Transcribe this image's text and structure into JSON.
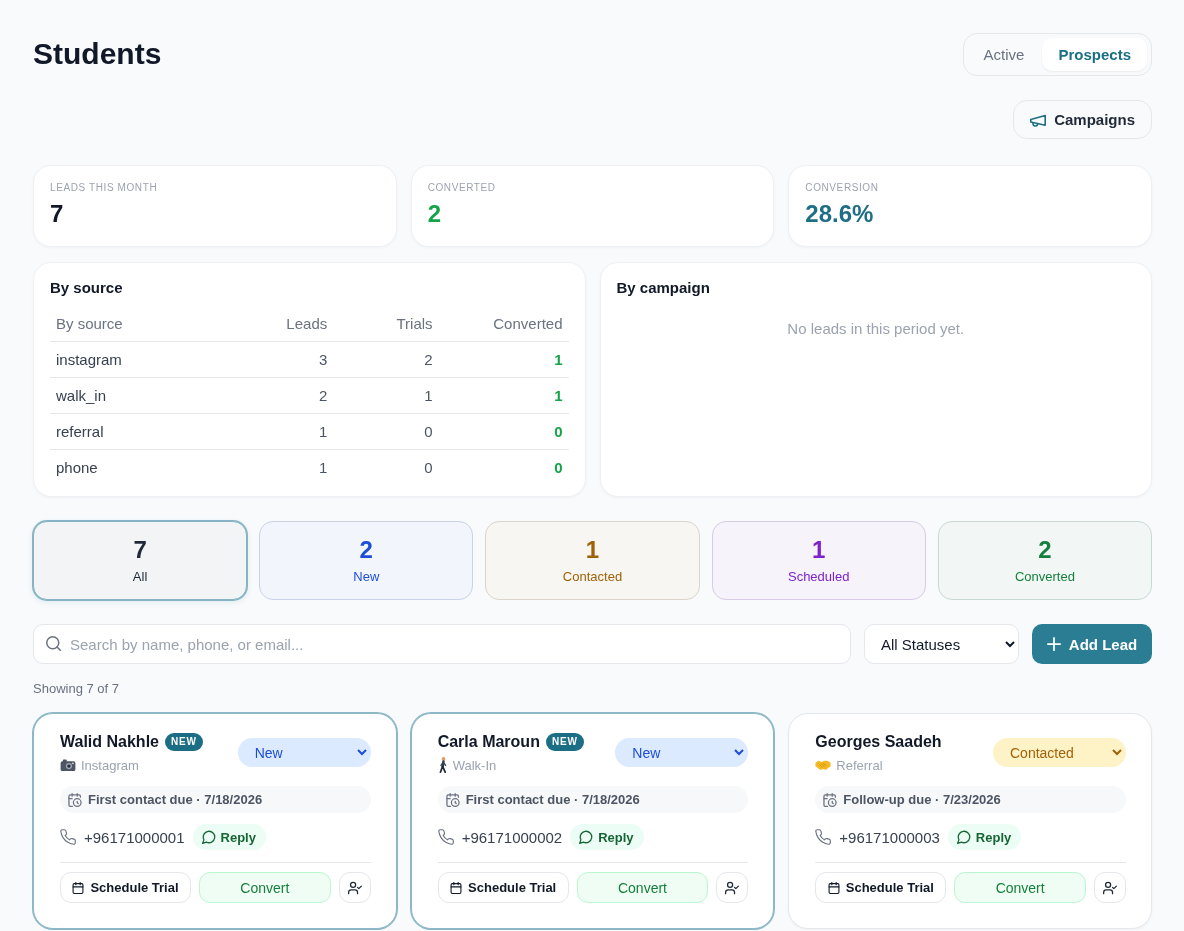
{
  "header": {
    "title": "Students",
    "view_toggle": [
      {
        "label": "Active",
        "selected": false
      },
      {
        "label": "Prospects",
        "selected": true
      }
    ],
    "campaigns_button": "Campaigns"
  },
  "stats": [
    {
      "label": "LEADS THIS MONTH",
      "value": "7",
      "color": "#111827"
    },
    {
      "label": "CONVERTED",
      "value": "2",
      "color": "#16a34a"
    },
    {
      "label": "CONVERSION",
      "value": "28.6%",
      "color": "#1e6f86"
    }
  ],
  "by_source": {
    "title": "By source",
    "columns": [
      "By source",
      "Leads",
      "Trials",
      "Converted"
    ],
    "rows": [
      {
        "cells": [
          "instagram",
          "3",
          "2",
          "1"
        ]
      },
      {
        "cells": [
          "walk_in",
          "2",
          "1",
          "1"
        ]
      },
      {
        "cells": [
          "referral",
          "1",
          "0",
          "0"
        ]
      },
      {
        "cells": [
          "phone",
          "1",
          "0",
          "0"
        ]
      }
    ]
  },
  "by_campaign": {
    "title": "By campaign",
    "empty_message": "No leads in this period yet."
  },
  "status_filters": [
    {
      "count": "7",
      "label": "All",
      "color": "#1f2937",
      "selected": true
    },
    {
      "count": "2",
      "label": "New",
      "color": "#1d4ed8",
      "selected": false
    },
    {
      "count": "1",
      "label": "Contacted",
      "color": "#a16207",
      "selected": false
    },
    {
      "count": "1",
      "label": "Scheduled",
      "color": "#7e22ce",
      "selected": false
    },
    {
      "count": "2",
      "label": "Converted",
      "color": "#15803d",
      "selected": false
    }
  ],
  "toolbar": {
    "search": {
      "placeholder": "Search by name, phone, or email..."
    },
    "status_select": {
      "value": "All Statuses"
    },
    "add_button": "Add Lead"
  },
  "result_count": "Showing 7 of 7",
  "leads": [
    {
      "name": "Walid Nakhle",
      "badge": "NEW",
      "highlighted": true,
      "source": {
        "kind": "instagram",
        "label": "Instagram"
      },
      "status": {
        "kind": "new",
        "label": "New"
      },
      "due": "First contact due · 7/18/2026",
      "phone": "+96171000001",
      "reply_button": "Reply",
      "actions": {
        "schedule": "Schedule Trial",
        "convert": "Convert"
      }
    },
    {
      "name": "Carla Maroun",
      "badge": "NEW",
      "highlighted": true,
      "source": {
        "kind": "walk_in",
        "label": "Walk-In"
      },
      "status": {
        "kind": "new",
        "label": "New"
      },
      "due": "First contact due · 7/18/2026",
      "phone": "+96171000002",
      "reply_button": "Reply",
      "actions": {
        "schedule": "Schedule Trial",
        "convert": "Convert"
      }
    },
    {
      "name": "Georges Saadeh",
      "highlighted": false,
      "source": {
        "kind": "referral",
        "label": "Referral"
      },
      "status": {
        "kind": "contacted",
        "label": "Contacted"
      },
      "due": "Follow-up due · 7/23/2026",
      "phone": "+96171000003",
      "reply_button": "Reply",
      "actions": {
        "schedule": "Schedule Trial",
        "convert": "Convert"
      }
    }
  ]
}
